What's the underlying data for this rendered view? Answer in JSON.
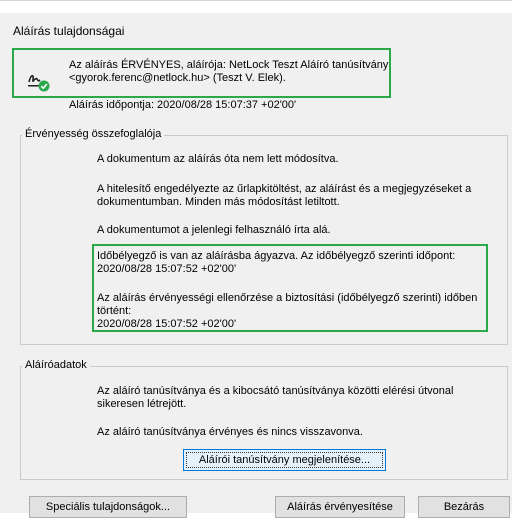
{
  "dialog": {
    "title": "Aláírás tulajdonságai"
  },
  "signature": {
    "status_line1": "Az aláírás ÉRVÉNYES, aláírója: NetLock Teszt Aláíró tanúsítvány",
    "status_line2": "<gyorok.ferenc@netlock.hu> (Teszt V. Elek).",
    "signing_time": "Aláírás időpontja:  2020/08/28 15:07:37 +02'00'"
  },
  "validity": {
    "group_label": "Érvényesség összefoglalója",
    "p1": "A dokumentum az aláírás óta nem lett módosítva.",
    "p2a": "A hitelesítő engedélyezte az űrlapkitöltést, az aláírást és a megjegyzéseket a",
    "p2b": "dokumentumban. Minden más módosítást letiltott.",
    "p3": "A dokumentumot a jelenlegi felhasználó írta alá.",
    "ts1a": "Időbélyegző is van az aláírásba ágyazva. Az időbélyegző szerinti időpont:",
    "ts1b": "2020/08/28 15:07:52 +02'00'",
    "ts2a": "Az aláírás érvényességi ellenőrzése a biztosítási (időbélyegző szerinti) időben",
    "ts2b": "történt:",
    "ts2c": "2020/08/28 15:07:52 +02'00'"
  },
  "signer": {
    "group_label": "Aláíróadatok",
    "p1a": "Az aláíró tanúsítványa és a kibocsátó tanúsítványa közötti elérési útvonal",
    "p1b": "sikeresen létrejött.",
    "p2": "Az aláíró tanúsítványa érvényes és nincs visszavonva.",
    "show_cert_button": "Aláírói tanúsítvány megjelenítése..."
  },
  "buttons": {
    "special_props": "Speciális tulajdonságok...",
    "validate": "Aláírás érvényesítése",
    "close": "Bezárás"
  },
  "colors": {
    "highlight": "#2aa84a",
    "status_ok": "#2aa84a"
  }
}
